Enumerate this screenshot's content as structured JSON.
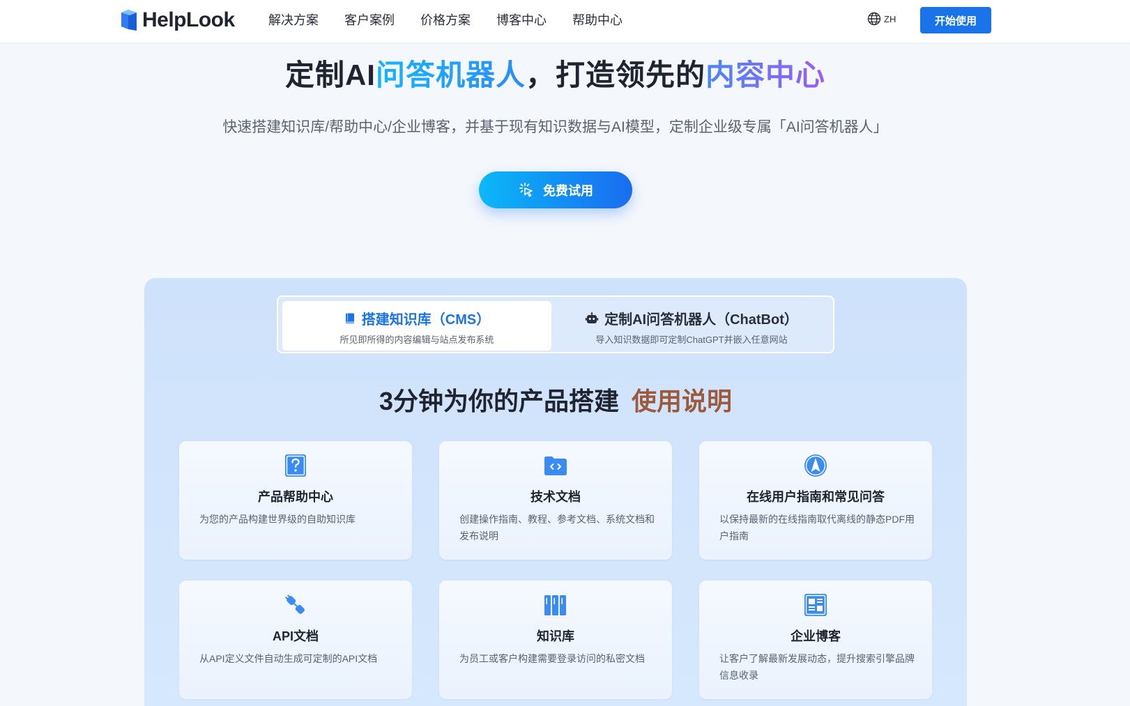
{
  "nav": {
    "brand": "HelpLook",
    "links": [
      "解决方案",
      "客户案例",
      "价格方案",
      "博客中心",
      "帮助中心"
    ],
    "lang": "ZH",
    "start_label": "开始使用"
  },
  "hero": {
    "title_parts": [
      "定制AI",
      "问答机器人",
      "，打造领先的",
      "内容中心"
    ],
    "subtitle": "快速搭建知识库/帮助中心/企业博客，并基于现有知识数据与AI模型，定制企业级专属「AI问答机器人」",
    "trial_label": "免费试用"
  },
  "tabs": [
    {
      "title": "搭建知识库（CMS）",
      "desc": "所见即所得的内容编辑与站点发布系统",
      "icon": "book-icon",
      "active": true
    },
    {
      "title": "定制AI问答机器人（ChatBot）",
      "desc": "导入知识数据即可定制ChatGPT并嵌入任意网站",
      "icon": "robot-icon",
      "active": false
    }
  ],
  "section": {
    "title": "3分钟为你的产品搭建",
    "accent": "使用说明"
  },
  "cards": [
    {
      "icon": "question-icon",
      "title": "产品帮助中心",
      "desc": "为您的产品构建世界级的自助知识库"
    },
    {
      "icon": "code-folder-icon",
      "title": "技术文档",
      "desc": "创建操作指南、教程、参考文档、系统文档和发布说明"
    },
    {
      "icon": "navigation-icon",
      "title": "在线用户指南和常见问答",
      "desc": "以保持最新的在线指南取代离线的静态PDF用户指南"
    },
    {
      "icon": "plug-icon",
      "title": "API文档",
      "desc": "从API定义文件自动生成可定制的API文档"
    },
    {
      "icon": "books-icon",
      "title": "知识库",
      "desc": "为员工或客户构建需要登录访问的私密文档"
    },
    {
      "icon": "blog-layout-icon",
      "title": "企业博客",
      "desc": "让客户了解最新发展动态，提升搜索引擎品牌信息收录"
    }
  ],
  "colors": {
    "primary": "#1a73e8",
    "panel_bg": "#cfe2fb",
    "accent_brown": "#9b5a3c",
    "gradient_blue": "#18b4ff",
    "gradient_purple": "#9b5cf5"
  }
}
